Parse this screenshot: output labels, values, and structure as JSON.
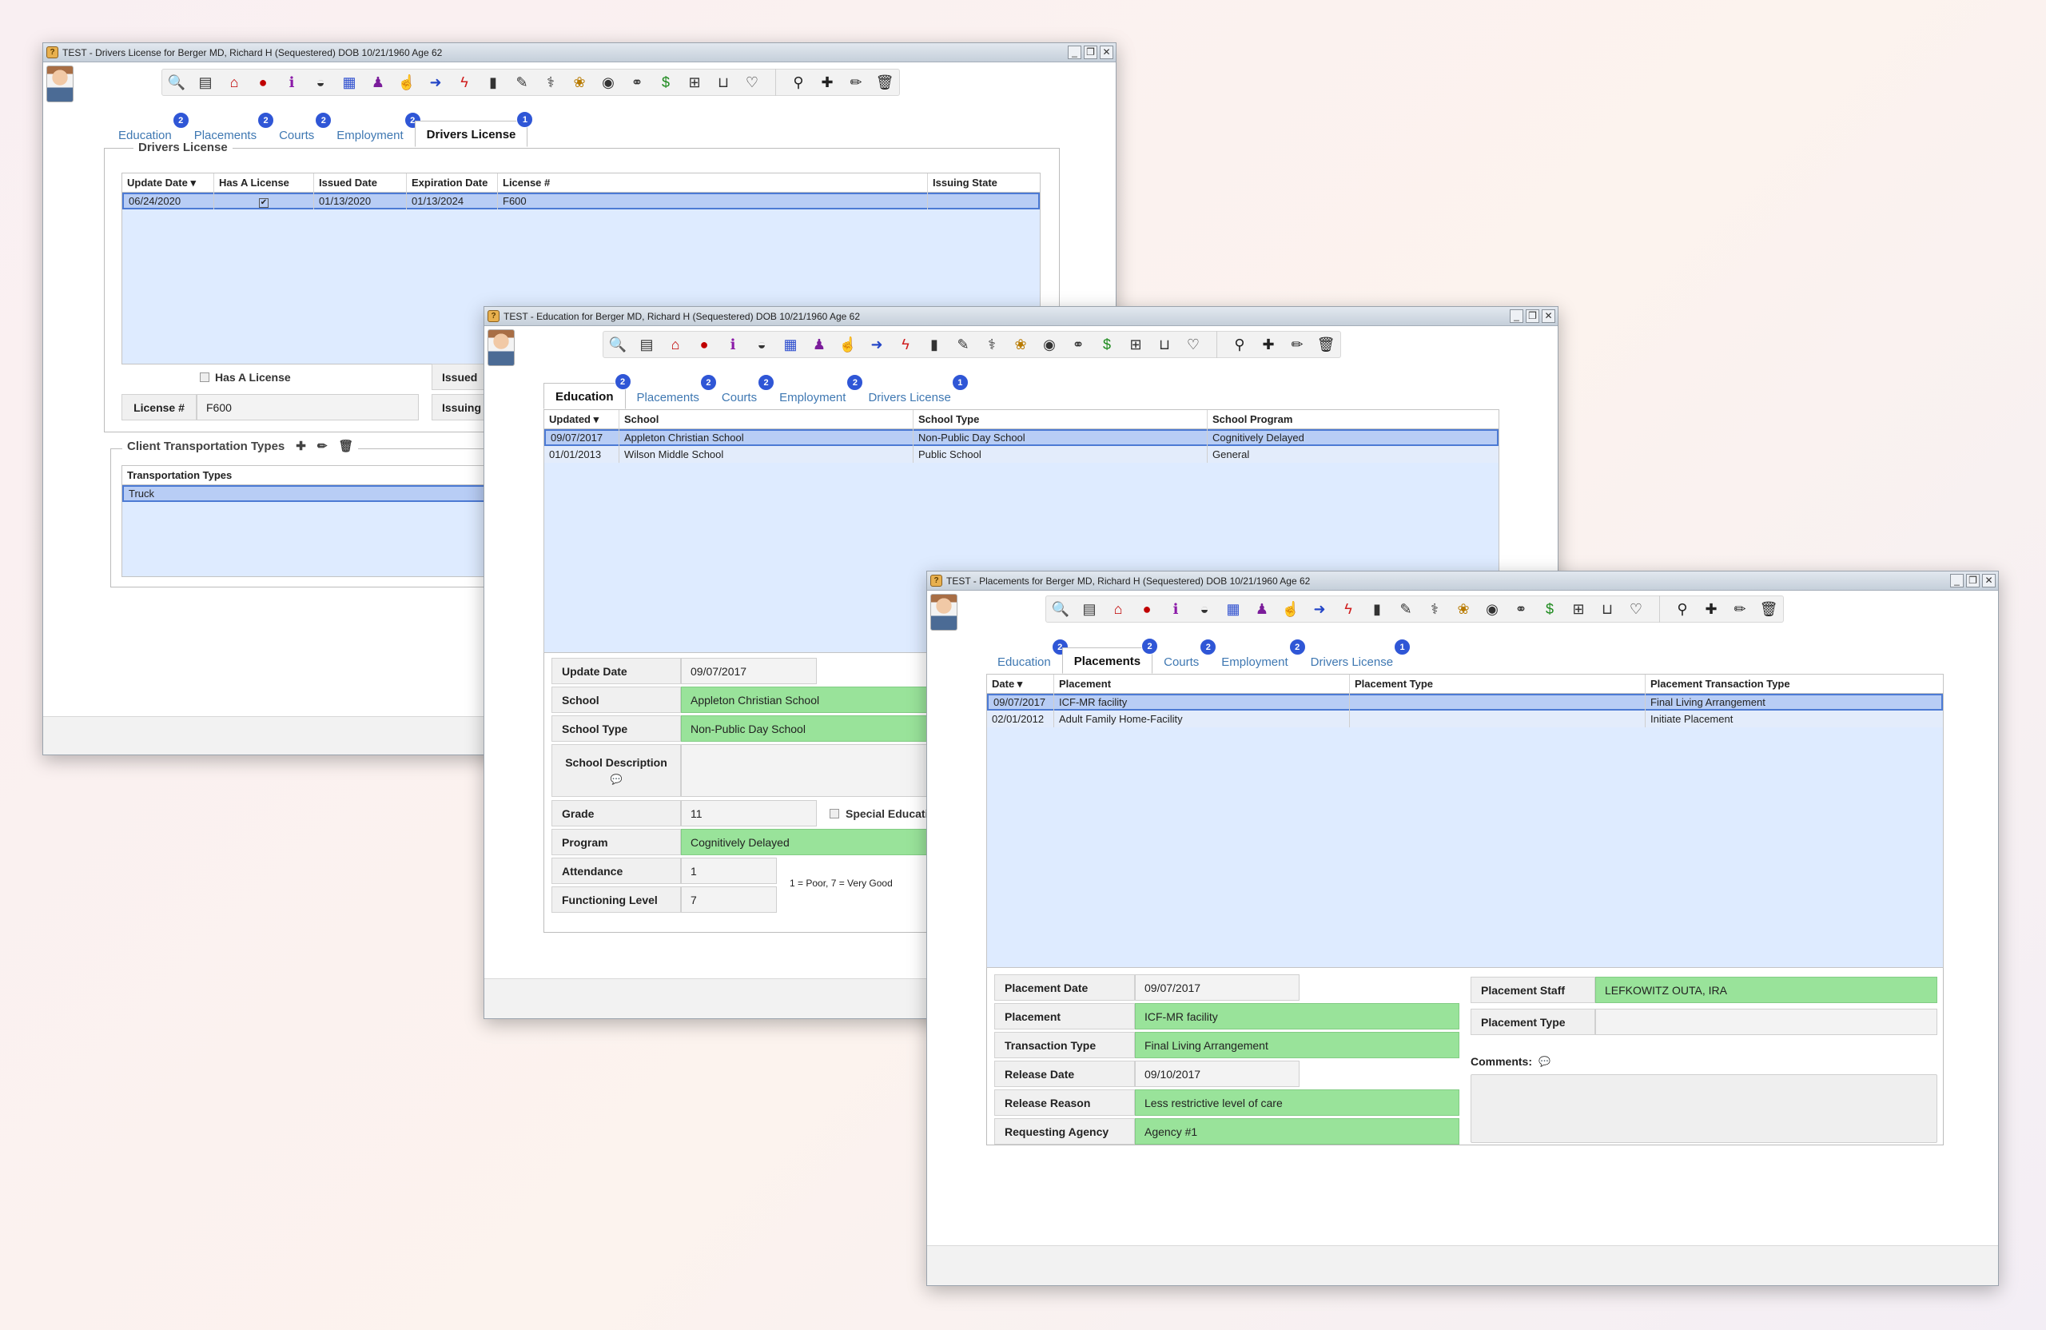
{
  "toolbar_icons": [
    {
      "name": "magnify-icon",
      "glyph": "🔍",
      "color": "#333"
    },
    {
      "name": "ledger-icon",
      "glyph": "▤",
      "color": "#333"
    },
    {
      "name": "home-icon",
      "glyph": "⌂",
      "color": "#c00000"
    },
    {
      "name": "red-dot-icon",
      "glyph": "●",
      "color": "#c00000"
    },
    {
      "name": "info-icon",
      "glyph": "ℹ",
      "color": "#8b1aa8"
    },
    {
      "name": "dashboard-icon",
      "glyph": "◒",
      "color": "#333"
    },
    {
      "name": "calendar-icon",
      "glyph": "▦",
      "color": "#2e4fcf"
    },
    {
      "name": "person-icon",
      "glyph": "♟",
      "color": "#7b1d9b"
    },
    {
      "name": "thumbs-up-icon",
      "glyph": "☝",
      "color": "#444"
    },
    {
      "name": "sign-in-icon",
      "glyph": "➜",
      "color": "#2446c7"
    },
    {
      "name": "bolt-icon",
      "glyph": "ϟ",
      "color": "#d02020"
    },
    {
      "name": "clipboard-icon",
      "glyph": "▮",
      "color": "#333"
    },
    {
      "name": "edit-icon",
      "glyph": "✎",
      "color": "#333"
    },
    {
      "name": "stethoscope-icon",
      "glyph": "⚕",
      "color": "#333"
    },
    {
      "name": "paw-icon",
      "glyph": "❀",
      "color": "#b87a00"
    },
    {
      "name": "eye-icon",
      "glyph": "◉",
      "color": "#333"
    },
    {
      "name": "rings-icon",
      "glyph": "⚭",
      "color": "#333"
    },
    {
      "name": "dollar-icon",
      "glyph": "$",
      "color": "#1d8a1d"
    },
    {
      "name": "medkit-icon",
      "glyph": "⊞",
      "color": "#333"
    },
    {
      "name": "inbox-icon",
      "glyph": "⊔",
      "color": "#333"
    },
    {
      "name": "heartbeat-icon",
      "glyph": "♡",
      "color": "#333"
    }
  ],
  "toolbar_actions": [
    {
      "name": "binoculars-icon",
      "glyph": "⚲"
    },
    {
      "name": "add-icon",
      "glyph": "✚"
    },
    {
      "name": "pencil-icon",
      "glyph": "✏"
    },
    {
      "name": "trash-icon",
      "glyph": "🗑"
    }
  ],
  "tabs": [
    {
      "label": "Education",
      "count": "2"
    },
    {
      "label": "Placements",
      "count": "2"
    },
    {
      "label": "Courts",
      "count": "2"
    },
    {
      "label": "Employment",
      "count": "2"
    },
    {
      "label": "Drivers License",
      "count": "1"
    }
  ],
  "win_dl": {
    "title": "TEST - Drivers License for Berger MD, Richard H (Sequestered) DOB 10/21/1960 Age 62",
    "section_title": "Drivers License",
    "columns": [
      "Update Date ▾",
      "Has A License",
      "Issued Date",
      "Expiration Date",
      "License #",
      "Issuing State"
    ],
    "rows": [
      {
        "update": "06/24/2020",
        "has": "✔",
        "issued": "01/13/2020",
        "expires": "01/13/2024",
        "license": "F600",
        "state": ""
      }
    ],
    "has_license_label": "Has A License",
    "license_label": "License #",
    "license_value": "F600",
    "issued_label": "Issued",
    "issuing_label": "Issuing",
    "transport_title": "Client Transportation Types",
    "transport_col": "Transportation Types",
    "transport_rows": [
      "Truck"
    ]
  },
  "win_edu": {
    "title": "TEST - Education for Berger MD, Richard H (Sequestered) DOB 10/21/1960 Age 62",
    "columns": [
      "Updated ▾",
      "School",
      "School Type",
      "School Program"
    ],
    "rows": [
      {
        "updated": "09/07/2017",
        "school": "Appleton Christian School",
        "type": "Non-Public Day School",
        "program": "Cognitively Delayed"
      },
      {
        "updated": "01/01/2013",
        "school": "Wilson Middle School",
        "type": "Public School",
        "program": "General"
      }
    ],
    "update_date_label": "Update Date",
    "update_date": "09/07/2017",
    "school_label": "School",
    "school": "Appleton Christian School",
    "school_type_label": "School Type",
    "school_type": "Non-Public Day School",
    "desc_label": "School Description",
    "grade_label": "Grade",
    "grade": "11",
    "special_label": "Special Educati",
    "program_label": "Program",
    "program": "Cognitively Delayed",
    "attendance_label": "Attendance",
    "attendance": "1",
    "functioning_label": "Functioning Level",
    "functioning": "7",
    "scale_note": "1 = Poor, 7 = Very Good"
  },
  "win_pl": {
    "title": "TEST - Placements for Berger MD, Richard H (Sequestered) DOB 10/21/1960 Age 62",
    "columns": [
      "Date ▾",
      "Placement",
      "Placement Type",
      "Placement Transaction Type"
    ],
    "rows": [
      {
        "date": "09/07/2017",
        "placement": "ICF-MR facility",
        "type": "",
        "transaction": "Final Living Arrangement"
      },
      {
        "date": "02/01/2012",
        "placement": "Adult Family Home-Facility",
        "type": "",
        "transaction": "Initiate Placement"
      }
    ],
    "placement_date_label": "Placement Date",
    "placement_date": "09/07/2017",
    "placement_label": "Placement",
    "placement": "ICF-MR facility",
    "transaction_label": "Transaction Type",
    "transaction": "Final Living Arrangement",
    "release_date_label": "Release Date",
    "release_date": "09/10/2017",
    "release_reason_label": "Release Reason",
    "release_reason": "Less restrictive level of care",
    "agency_label": "Requesting Agency",
    "agency": "Agency #1",
    "staff_label": "Placement Staff",
    "staff": "LEFKOWITZ OUTA, IRA",
    "ptype_label": "Placement Type",
    "ptype": "",
    "comments_label": "Comments:"
  }
}
